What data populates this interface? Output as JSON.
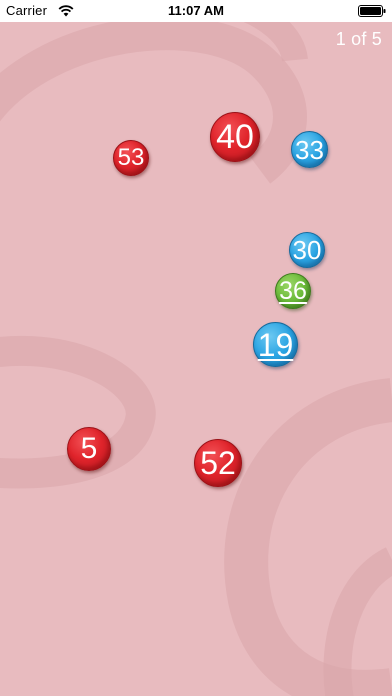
{
  "status_bar": {
    "carrier": "Carrier",
    "time": "11:07 AM",
    "wifi_icon": "wifi-icon",
    "battery_icon": "battery-icon"
  },
  "pager": {
    "label": "1 of 5"
  },
  "balls": [
    {
      "id": "ball-40",
      "number": "40",
      "color": "red"
    },
    {
      "id": "ball-53",
      "number": "53",
      "color": "red"
    },
    {
      "id": "ball-33",
      "number": "33",
      "color": "blue"
    },
    {
      "id": "ball-30",
      "number": "30",
      "color": "blue"
    },
    {
      "id": "ball-36",
      "number": "36",
      "color": "green",
      "underlined": true
    },
    {
      "id": "ball-19",
      "number": "19",
      "color": "blue",
      "underlined": true
    },
    {
      "id": "ball-5",
      "number": "5",
      "color": "red"
    },
    {
      "id": "ball-52",
      "number": "52",
      "color": "red"
    }
  ],
  "colors": {
    "background": "#e8bbbf",
    "red": "#e0242b",
    "blue": "#2aa4e3",
    "green": "#6cbb3a"
  }
}
